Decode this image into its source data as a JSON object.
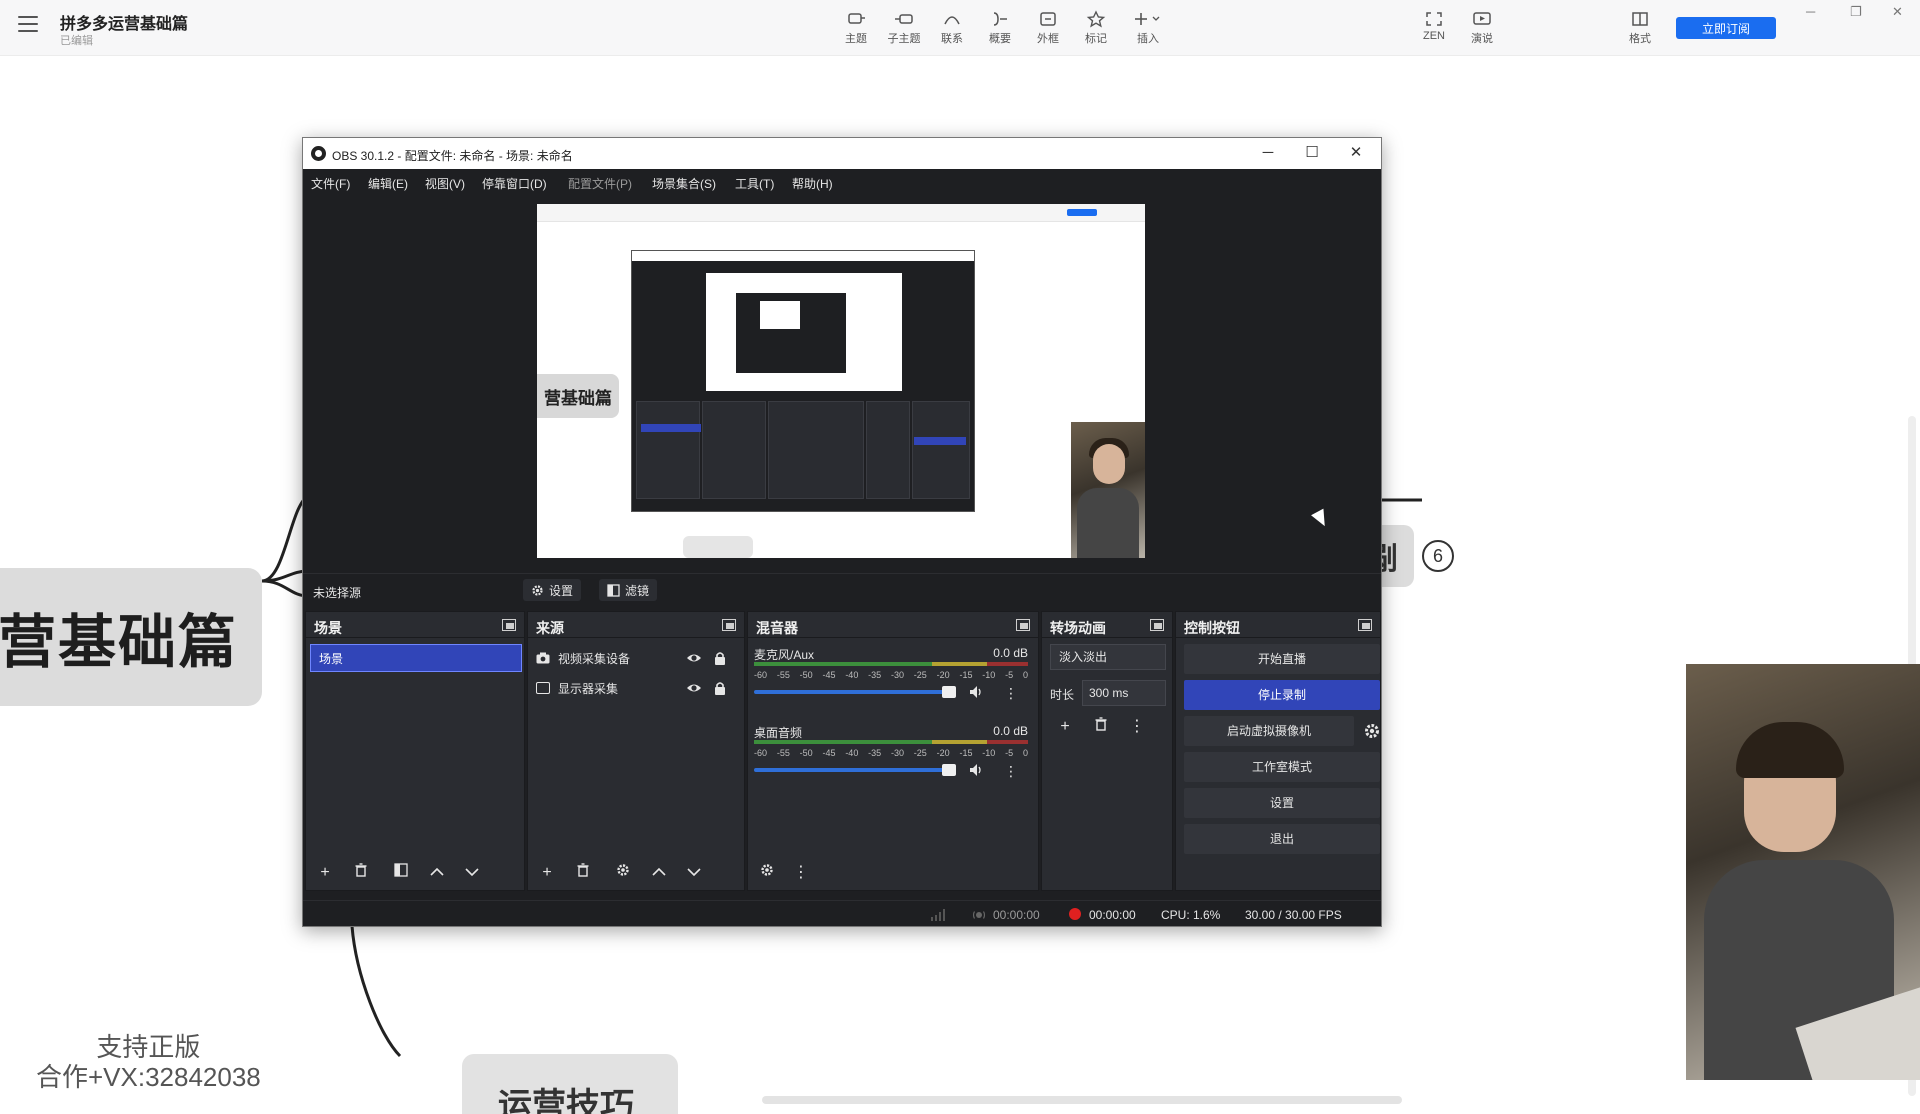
{
  "app": {
    "doc_title": "拼多多运营基础篇",
    "doc_status": "已编辑",
    "toolbar": [
      {
        "label": "主题",
        "icon": "topic-icon"
      },
      {
        "label": "子主题",
        "icon": "subtopic-icon"
      },
      {
        "label": "联系",
        "icon": "relation-icon"
      },
      {
        "label": "概要",
        "icon": "summary-icon"
      },
      {
        "label": "外框",
        "icon": "boundary-icon"
      },
      {
        "label": "标记",
        "icon": "star-icon"
      },
      {
        "label": "插入",
        "icon": "insert-icon"
      },
      {
        "label": "ZEN",
        "icon": "zen-icon"
      },
      {
        "label": "演说",
        "icon": "pitch-icon"
      },
      {
        "label": "格式",
        "icon": "format-icon"
      }
    ],
    "subscribe_label": "立即订阅",
    "accent": "#1a6df0"
  },
  "canvas": {
    "root_node": "营基础篇",
    "bottom_node": "运营技巧",
    "right_node": "剐",
    "badge": "6",
    "watermark_line1": "支持正版",
    "watermark_line2": "合作+VX:32842038"
  },
  "obs": {
    "title": "OBS 30.1.2 - 配置文件: 未命名 - 场景: 未命名",
    "menus": [
      "文件(F)",
      "编辑(E)",
      "视图(V)",
      "停靠窗口(D)",
      "配置文件(P)",
      "场景集合(S)",
      "工具(T)",
      "帮助(H)"
    ],
    "preview_node": "营基础篇",
    "no_source": "未选择源",
    "properties_label": "设置",
    "filters_label": "滤镜",
    "docks": {
      "scenes": {
        "title": "场景",
        "items": [
          "场景"
        ]
      },
      "sources": {
        "title": "来源",
        "items": [
          "视频采集设备",
          "显示器采集"
        ]
      },
      "mixer": {
        "title": "混音器",
        "channels": [
          {
            "name": "麦克风/Aux",
            "db": "0.0 dB"
          },
          {
            "name": "桌面音频",
            "db": "0.0 dB"
          }
        ],
        "ticks": [
          "-60",
          "-55",
          "-50",
          "-45",
          "-40",
          "-35",
          "-30",
          "-25",
          "-20",
          "-15",
          "-10",
          "-5",
          "0"
        ]
      },
      "transitions": {
        "title": "转场动画",
        "type": "淡入淡出",
        "duration_label": "时长",
        "duration": "300 ms"
      },
      "controls": {
        "title": "控制按钮",
        "buttons": [
          "开始直播",
          "停止录制",
          "启动虚拟摄像机",
          "工作室模式",
          "设置",
          "退出"
        ]
      }
    },
    "status": {
      "stream_time": "00:00:00",
      "record_time": "00:00:00",
      "cpu": "CPU: 1.6%",
      "fps": "30.00 / 30.00 FPS"
    },
    "colors": {
      "bg": "#1e1f22",
      "dock": "#2a2c31",
      "selected": "#3145b8",
      "recording": "#e02020"
    }
  }
}
